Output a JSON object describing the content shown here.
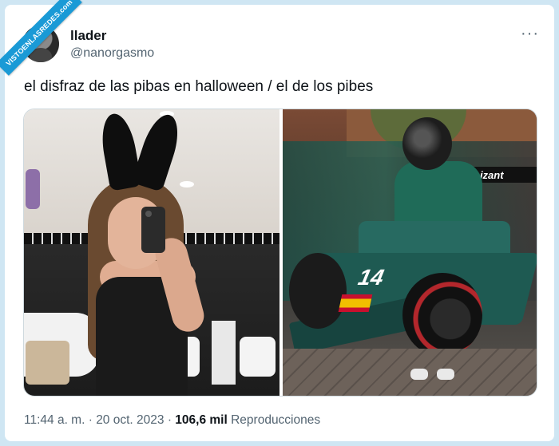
{
  "watermark": {
    "text": "VISTOENLASREDES.com"
  },
  "author": {
    "display_name": "llader",
    "handle": "@nanorgasmo"
  },
  "more_menu": {
    "label": "···"
  },
  "tweet": {
    "text": "el disfraz de las pibas en halloween / el de los pibes"
  },
  "media": {
    "left_photo": {
      "description_icon": "photo-icon"
    },
    "right_photo": {
      "banner_text": "nizant",
      "car_number": "14"
    }
  },
  "meta": {
    "time": "11:44 a. m.",
    "separator": " · ",
    "date": "20 oct. 2023",
    "separator2": " · ",
    "views_count": "106,6 mil",
    "views_label": " Reproducciones"
  },
  "colors": {
    "background": "#cfe6f3",
    "card": "#ffffff",
    "text_primary": "#0f1419",
    "text_secondary": "#536471",
    "ribbon": "#1a9ad6"
  }
}
